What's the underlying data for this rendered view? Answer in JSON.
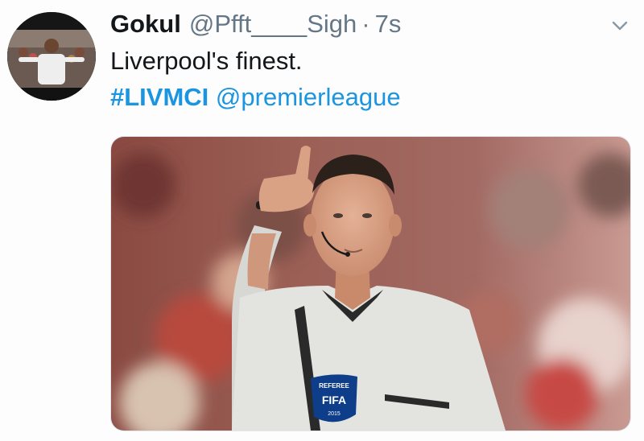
{
  "tweet": {
    "display_name": "Gokul",
    "handle": "@Pfft____Sigh",
    "separator": "·",
    "time": "7s",
    "text": "Liverpool's finest.",
    "hashtag": "#LIVMCI",
    "mention": "@premierleague"
  },
  "media": {
    "badge_text": "REFEREE",
    "badge_brand": "FIFA",
    "badge_year": "2015"
  },
  "icons": {
    "menu": "chevron-down-icon",
    "avatar": "avatar-image"
  },
  "colors": {
    "link": "#1b95e0",
    "secondary_text": "#657786",
    "primary_text": "#14171a"
  }
}
